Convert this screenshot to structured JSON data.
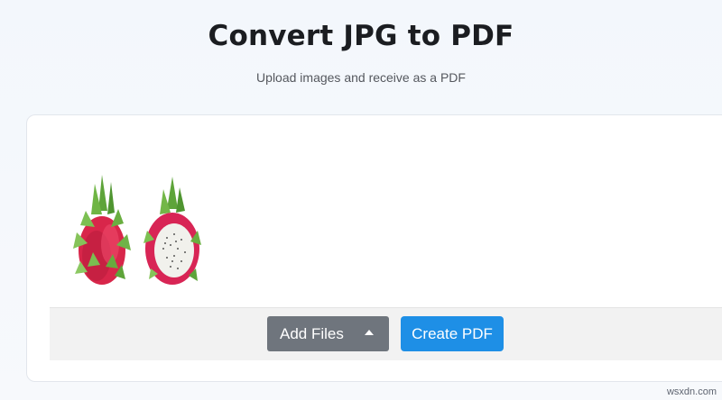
{
  "header": {
    "title": "Convert JPG to PDF",
    "subtitle": "Upload images and receive as a PDF"
  },
  "upload": {
    "thumbnail_icon": "dragon-fruit-image"
  },
  "toolbar": {
    "add_files_label": "Add Files",
    "add_files_menu_icon": "caret-up-icon",
    "create_pdf_label": "Create PDF"
  },
  "colors": {
    "add_files_bg": "#6f757d",
    "create_pdf_bg": "#1e8fe6",
    "toolbar_bg": "#f2f2f2"
  },
  "watermark": "wsxdn.com"
}
